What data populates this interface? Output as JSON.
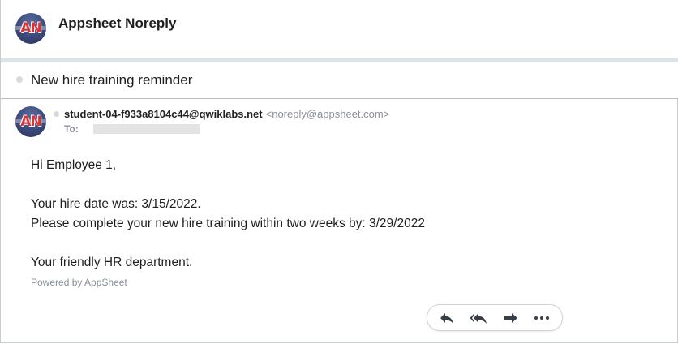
{
  "header": {
    "sender_name": "Appsheet Noreply",
    "avatar_initials": "AN"
  },
  "subject": "New hire training reminder",
  "message": {
    "from_address": "student-04-f933a8104c44@qwiklabs.net",
    "reply_address": "<noreply@appsheet.com>",
    "to_label": "To:",
    "greeting": "Hi Employee 1,",
    "line1": "Your hire date was: 3/15/2022.",
    "line2": "Please complete your new hire training within two weeks by: 3/29/2022",
    "signoff": "Your friendly HR department.",
    "powered_by": "Powered by AppSheet"
  },
  "actions": [
    "reply-icon",
    "reply-all-icon",
    "forward-icon",
    "more-icon"
  ]
}
